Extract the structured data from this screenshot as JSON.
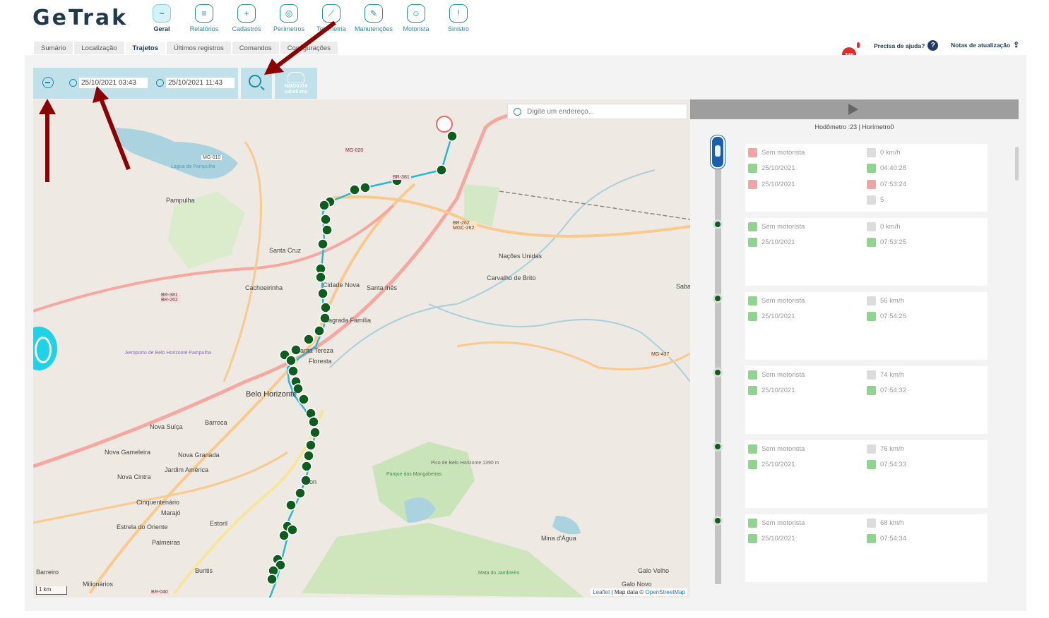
{
  "app": {
    "logo": "GeTrak"
  },
  "topnav": [
    {
      "label": "Geral",
      "icon": "monitor-icon",
      "active": true
    },
    {
      "label": "Relatórios",
      "icon": "report-icon"
    },
    {
      "label": "Cadastros",
      "icon": "folder-plus-icon"
    },
    {
      "label": "Perímetros",
      "icon": "target-icon"
    },
    {
      "label": "Telemetria",
      "icon": "leaf-icon"
    },
    {
      "label": "Manutenções",
      "icon": "wrench-icon"
    },
    {
      "label": "Motorista",
      "icon": "driver-icon"
    },
    {
      "label": "Sinistro",
      "icon": "alarm-icon"
    }
  ],
  "tabs": [
    "Sumário",
    "Localização",
    "Trajetos",
    "Últimos registros",
    "Comandos",
    "Configurações"
  ],
  "active_tab": "Trajetos",
  "header": {
    "notification_count": "246",
    "help_label": "Precisa de ajuda?",
    "updates_label": "Notas de atualização"
  },
  "filter": {
    "start_datetime": "25/10/2021 03:43",
    "end_datetime": "25/10/2021 11:43",
    "vehicle_label": "NMO0J14 cabelinho"
  },
  "map": {
    "search_placeholder": "Digite um endereço...",
    "attribution_leaflet": "Leaflet",
    "attribution_text": " | Map data © ",
    "attribution_osm": "OpenStreetMap",
    "scale_label": "1 km",
    "places": [
      "Pampulha",
      "Santa Cruz",
      "Cachoeirinha",
      "Cidade Nova",
      "Santa Inês",
      "Nações Unidas",
      "Carvalho de Brito",
      "Sagrada Família",
      "Santa Tereza",
      "Floresta",
      "Belo Horizonte",
      "Barroca",
      "Nova Suíça",
      "Nova Gameleira",
      "Nova Granada",
      "Jardim América",
      "Nova Cintra",
      "Cinquentenário",
      "Marajó",
      "Estrela do Oriente",
      "Estoril",
      "Palmeiras",
      "Buritis",
      "Barreiro",
      "Milionários",
      "Sion",
      "Mina d'Água",
      "Galo Velho",
      "Galo Novo",
      "Pico de Belo Horizonte 1390 m",
      "Parque das Mangabeiras",
      "Mata do Jambreiro",
      "Aeroporto de Belo Horizonte Pampulha",
      "Lagoa da Pampulha",
      "Sabará"
    ],
    "road_badges": [
      "MG-010",
      "MG-020",
      "BR-381",
      "BR-262 MGC-262",
      "BR-381 BR-262",
      "MG-437",
      "BR-040"
    ]
  },
  "trip": {
    "summary": "Hodômetro :23 | Horímetro0",
    "events": [
      {
        "driver": "Sem motorista",
        "speed": "0 km/h",
        "date": "25/10/2021",
        "time": "04:40:28",
        "date2": "25/10/2021",
        "time2": "07:53:24",
        "extra": "5",
        "marker": "car"
      },
      {
        "driver": "Sem motorista",
        "speed": "0 km/h",
        "date": "25/10/2021",
        "time": "07:53:25",
        "marker": "dot"
      },
      {
        "driver": "Sem motorista",
        "speed": "56 km/h",
        "date": "25/10/2021",
        "time": "07:54:25",
        "marker": "dot"
      },
      {
        "driver": "Sem motorista",
        "speed": "74 km/h",
        "date": "25/10/2021",
        "time": "07:54:32",
        "marker": "dot"
      },
      {
        "driver": "Sem motorista",
        "speed": "76 km/h",
        "date": "25/10/2021",
        "time": "07:54:33",
        "marker": "dot"
      },
      {
        "driver": "Sem motorista",
        "speed": "68 km/h",
        "date": "25/10/2021",
        "time": "07:54:34",
        "marker": "dot"
      }
    ]
  },
  "colors": {
    "accent": "#1b8fa3",
    "route": "#2ab6d6",
    "marker": "#0e5d1e",
    "annotation_arrow": "#8b0000"
  }
}
